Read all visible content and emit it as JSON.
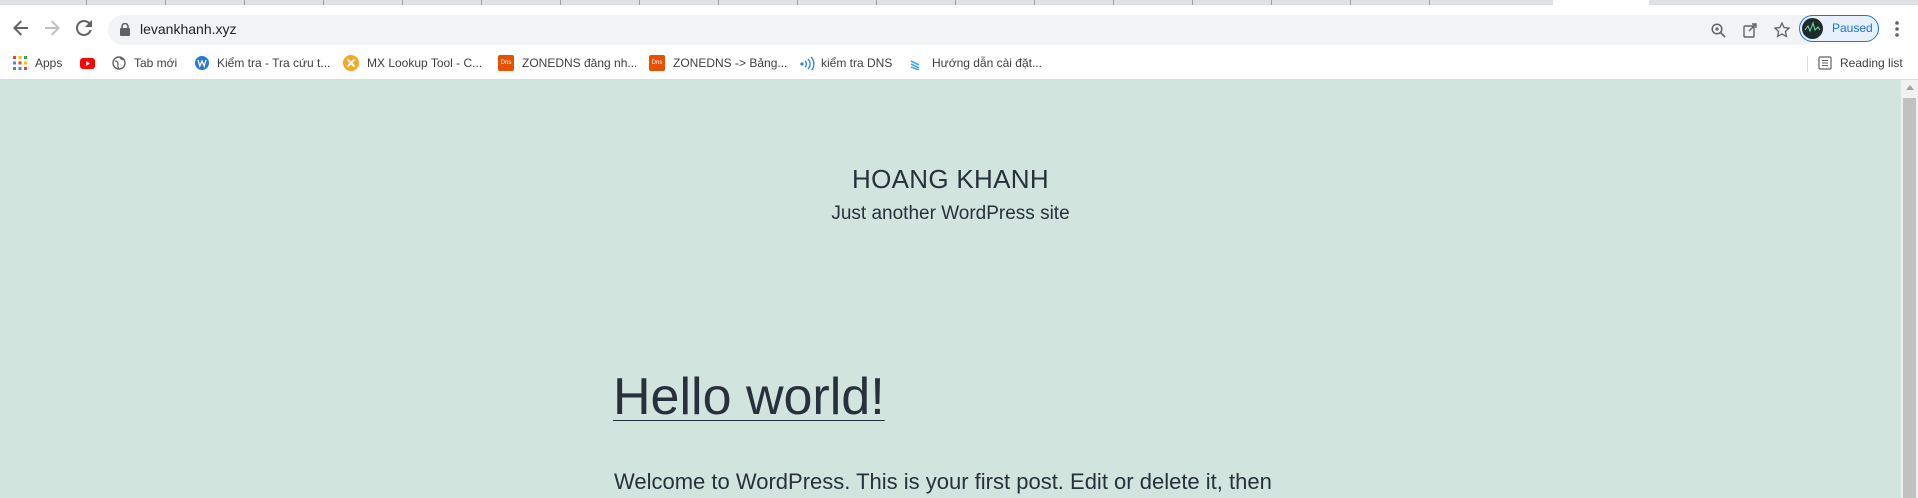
{
  "browser": {
    "url": "levankhanh.xyz",
    "profile_label": "Paused",
    "accent": "#1a73e8",
    "icons": [
      "back-arrow-icon",
      "forward-arrow-icon",
      "reload-icon",
      "lock-icon",
      "zoom-icon",
      "share-icon",
      "star-icon",
      "kebab-menu-icon"
    ]
  },
  "bookmarks": [
    {
      "label": "Apps",
      "icon": "apps-grid-icon"
    },
    {
      "label": "",
      "icon": "youtube-icon"
    },
    {
      "label": "Tab mới",
      "icon": "globe-icon"
    },
    {
      "label": "Kiểm tra - Tra cứu t...",
      "icon": "w-icon"
    },
    {
      "label": "MX Lookup Tool - C...",
      "icon": "mx-icon"
    },
    {
      "label": "ZONEDNS đăng nh...",
      "icon": "dns-icon"
    },
    {
      "label": "ZONEDNS -> Bảng...",
      "icon": "dns-icon"
    },
    {
      "label": "kiểm tra DNS",
      "icon": "wifi-icon"
    },
    {
      "label": "Hướng dẫn cài đặt...",
      "icon": "stack-icon"
    }
  ],
  "reading_list": {
    "label": "Reading list",
    "icon": "reading-list-icon"
  },
  "site": {
    "title": "HOANG KHANH",
    "description": "Just another WordPress site",
    "background": "#d1e4dd",
    "text_color": "#28303d"
  },
  "post": {
    "title": "Hello world!",
    "excerpt": "Welcome to WordPress. This is your first post. Edit or delete it, then"
  }
}
